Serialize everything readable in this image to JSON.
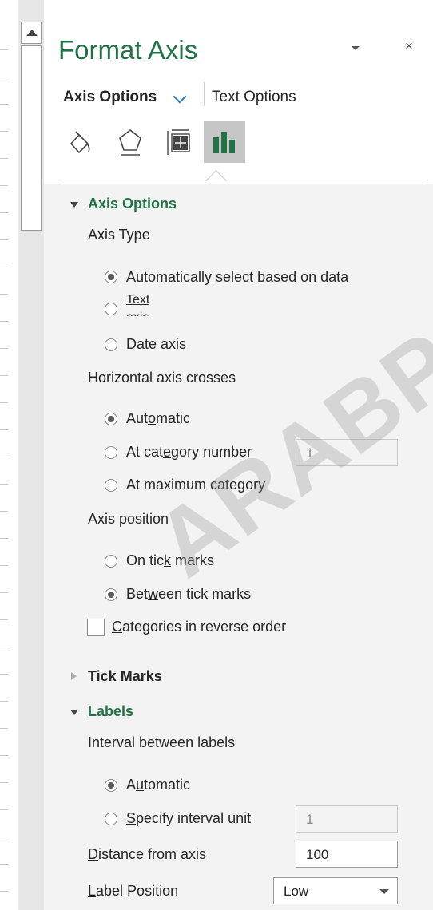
{
  "pane": {
    "title": "Format Axis",
    "close_label": "×"
  },
  "tabs": {
    "axis_options": "Axis Options",
    "text_options": "Text Options"
  },
  "icons": [
    "fill-line-icon",
    "effects-icon",
    "size-properties-icon",
    "axis-options-icon"
  ],
  "colors": {
    "accent": "#217346",
    "selected_icon_bg": "#c6c6c6",
    "panel_bg": "#f3f3f3"
  },
  "sections": {
    "axis_options": {
      "header": "Axis Options",
      "axis_type": {
        "label": "Axis Type",
        "auto": {
          "pre": "Automaticall",
          "u": "y",
          "post": " select based on data",
          "selected": true
        },
        "text": {
          "line1": "Text",
          "line2": "axis",
          "selected": false
        },
        "date": {
          "pre": "Date a",
          "u": "x",
          "post": "is",
          "selected": false
        }
      },
      "crosses": {
        "label": "Horizontal axis crosses",
        "auto": {
          "pre": "Aut",
          "u": "o",
          "post": "matic",
          "selected": true
        },
        "at_number": {
          "pre": "At cat",
          "u": "e",
          "post": "gory number",
          "value": "1",
          "selected": false
        },
        "at_max": {
          "pre": "At maximum cate",
          "u": "g",
          "post": "ory",
          "selected": false
        }
      },
      "position": {
        "label": "Axis position",
        "on_ticks": {
          "pre": "On tic",
          "u": "k",
          "post": " marks",
          "selected": false
        },
        "between": {
          "pre": "Bet",
          "u": "w",
          "post": "een tick marks",
          "selected": true
        }
      },
      "reverse": {
        "u": "C",
        "post": "ategories in reverse order",
        "checked": false
      }
    },
    "tick_marks": {
      "header": "Tick Marks"
    },
    "labels": {
      "header": "Labels",
      "interval_label": "Interval between labels",
      "auto": {
        "pre": "A",
        "u": "u",
        "post": "tomatic",
        "selected": true
      },
      "specify": {
        "u": "S",
        "post": "pecify interval unit",
        "value": "1",
        "selected": false
      },
      "distance": {
        "u": "D",
        "post": "istance from axis",
        "value": "100"
      },
      "label_position": {
        "u": "L",
        "post": "abel Position",
        "value": "Low"
      }
    }
  },
  "watermark": "ARABPSYC"
}
